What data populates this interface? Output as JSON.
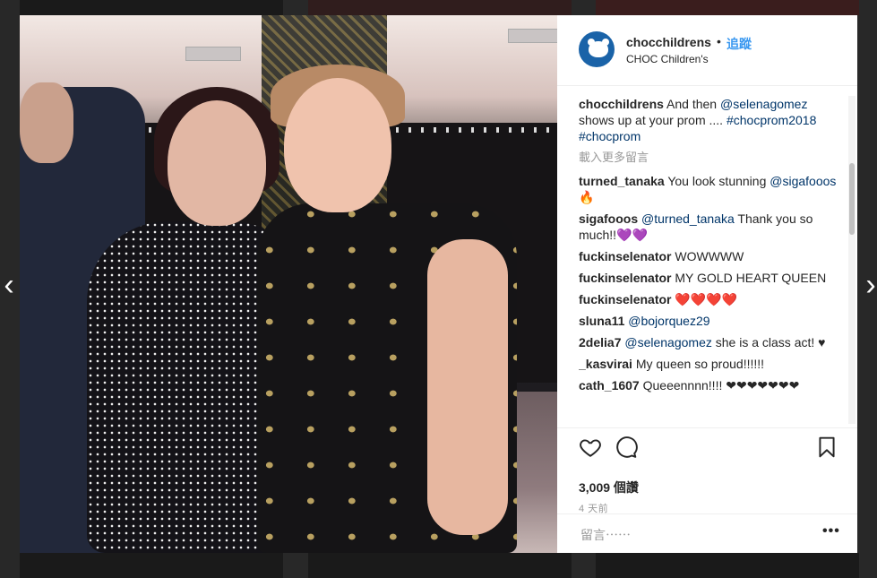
{
  "post": {
    "username": "chocchildrens",
    "separator": "•",
    "follow_label": "追蹤",
    "subtitle": "CHOC Children's",
    "caption": {
      "user": "chocchildrens",
      "text_before": "And then ",
      "mention": "@selenagomez",
      "text_after": " shows up at your prom ....",
      "hashtags": "#chocprom2018 #chocprom"
    },
    "load_more": "載入更多留言",
    "comments": [
      {
        "user": "turned_tanaka",
        "text": "You look stunning ",
        "mention": "@sigafooos",
        "tail": " 🔥"
      },
      {
        "user": "sigafooos",
        "mention": "@turned_tanaka",
        "text": " Thank you so much!!💜💜"
      },
      {
        "user": "fuckinselenator",
        "text": "WOWWWW"
      },
      {
        "user": "fuckinselenator",
        "text": "MY GOLD HEART QUEEN"
      },
      {
        "user": "fuckinselenator",
        "text": "❤️❤️❤️❤️"
      },
      {
        "user": "sluna11",
        "mention": "@bojorquez29",
        "text": ""
      },
      {
        "user": "2delia7",
        "mention": "@selenagomez",
        "text": " she is a class act! ♥"
      },
      {
        "user": "_kasvirai",
        "text": "My queen so proud!!!!!!"
      },
      {
        "user": "cath_1607",
        "text": "Queeennnn!!!! ❤❤❤❤❤❤❤"
      }
    ],
    "likes": "3,009 個讚",
    "time": "4 天前",
    "comment_placeholder": "留言⋯⋯",
    "more_label": "•••"
  },
  "navigation": {
    "prev": "‹",
    "next": "›"
  },
  "icons": {
    "like": "heart-icon",
    "comment": "comment-icon",
    "save": "bookmark-icon"
  },
  "colors": {
    "link": "#3897f0",
    "mention": "#003569",
    "brand": "#1a63a8"
  }
}
